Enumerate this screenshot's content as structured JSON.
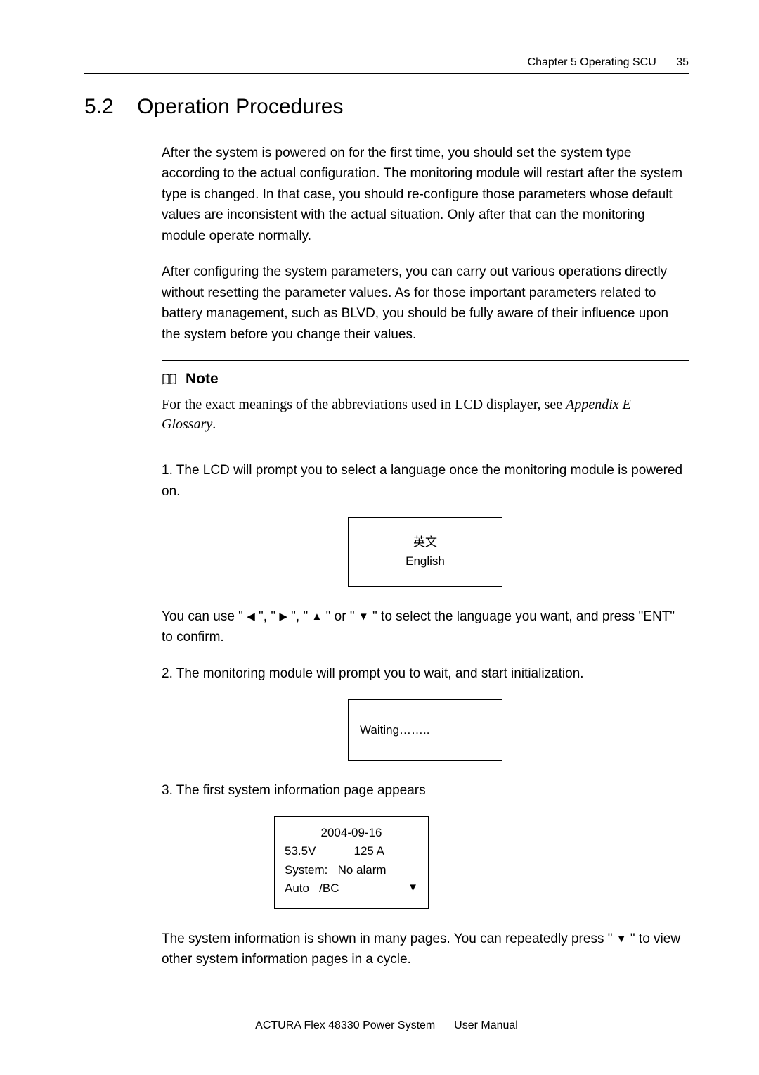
{
  "header": {
    "chapter": "Chapter  5    Operating SCU",
    "page_number": "35"
  },
  "section": {
    "number": "5.2",
    "title": "Operation Procedures"
  },
  "para1": "After the system is powered on for the first time, you should set the system type according to the actual configuration. The monitoring module will restart after the system type is changed. In that case, you should re-configure those parameters whose default values are inconsistent with the actual situation. Only after that can the monitoring module operate normally.",
  "para2": "After configuring the system parameters, you can carry out various operations directly without resetting the parameter values. As for those important parameters related to battery management, such as BLVD, you should be fully aware of their influence upon the system before you change their values.",
  "note": {
    "label": "Note",
    "body_pre": "For the exact meanings of the abbreviations used in LCD displayer, see ",
    "body_em": "Appendix E Glossary",
    "body_post": "."
  },
  "step1": "1. The LCD will prompt you to select a language once the monitoring module is powered on.",
  "lcd1": {
    "line1": "英文",
    "line2": "English"
  },
  "nav_line": {
    "pre": "You can use \" ",
    "mid1": " \", \" ",
    "mid2": " \", \" ",
    "mid3": " \" or \" ",
    "post": " \" to select the language you want, and press \"ENT\" to confirm."
  },
  "step2": "2. The monitoring module will prompt you to wait, and start initialization.",
  "lcd2": {
    "text": "Waiting…….."
  },
  "step3": "3. The first system information page appears",
  "lcd3": {
    "date": "2004-09-16",
    "volt": "53.5V",
    "amp": "125 A",
    "sys_label": "System:",
    "sys_val": "No alarm",
    "mode": "Auto",
    "bc": "/BC"
  },
  "para_after": {
    "pre": "The system information is shown in many pages. You can repeatedly press \" ",
    "post": " \" to view other system information pages in a cycle."
  },
  "footer": {
    "left": "ACTURA Flex 48330 Power System",
    "right": "User Manual"
  }
}
